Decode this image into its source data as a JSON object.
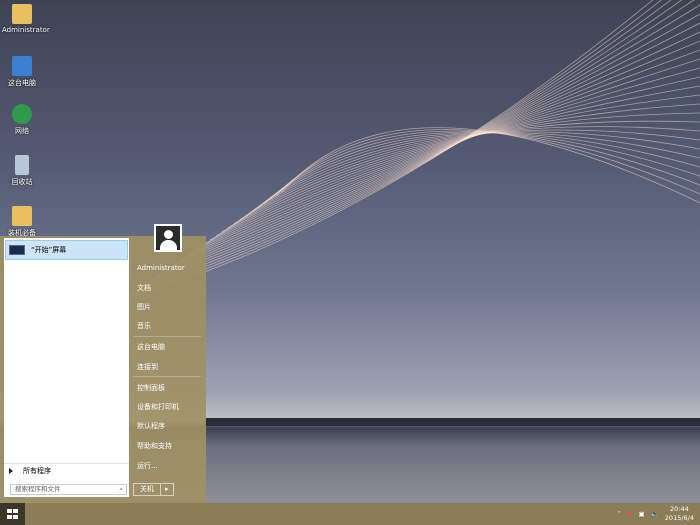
{
  "desktop": {
    "icons": [
      {
        "label": "Administrator",
        "icon": "user-folder-icon",
        "color": "#e8c060"
      },
      {
        "label": "这台电脑",
        "icon": "computer-icon",
        "color": "#3a7fd0"
      },
      {
        "label": "网络",
        "icon": "network-icon",
        "color": "#2f9a4a"
      },
      {
        "label": "回收站",
        "icon": "recycle-bin-icon",
        "color": "#b8c8d8"
      },
      {
        "label": "装机必备",
        "icon": "ie-folder-icon",
        "color": "#e8c060"
      }
    ]
  },
  "start_menu": {
    "pinned": "“开始”屏幕",
    "all_programs": "所有程序",
    "search_placeholder": "搜索程序和文件",
    "user": "Administrator",
    "right_items": [
      "文档",
      "图片",
      "音乐",
      "这台电脑",
      "连接到",
      "控制面板",
      "设备和打印机",
      "默认程序",
      "帮助和支持",
      "运行..."
    ],
    "shutdown": "关机",
    "accent": "#a09064"
  },
  "taskbar": {
    "time": "20:44",
    "date": "2015/6/4",
    "color": "#8a7d58"
  }
}
